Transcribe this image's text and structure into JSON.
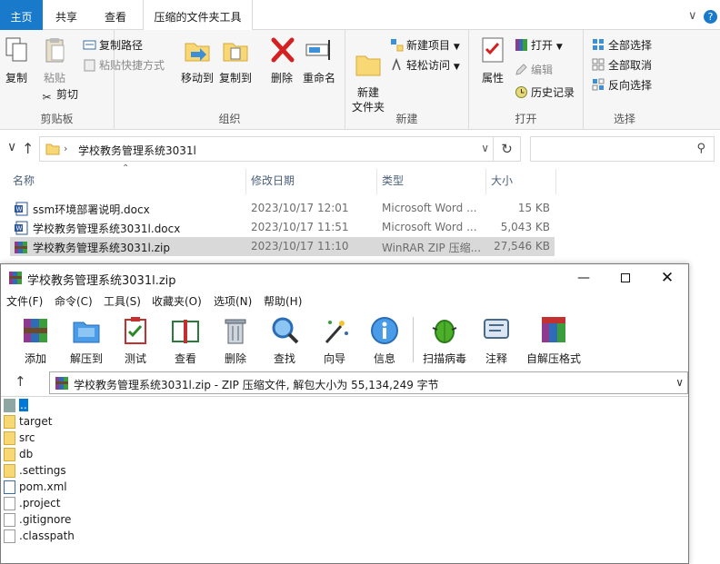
{
  "explorer": {
    "tabs": {
      "file": "主页",
      "share": "共享",
      "view": "查看",
      "tools": "压缩的文件夹工具"
    },
    "ribbon": {
      "clipboard": {
        "copy": "复制",
        "paste": "粘贴",
        "copy_path": "复制路径",
        "paste_shortcut": "粘贴快捷方式",
        "cut": "剪切",
        "label": "剪贴板"
      },
      "organize": {
        "move_to": "移动到",
        "copy_to": "复制到",
        "delete": "删除",
        "rename": "重命名",
        "label": "组织"
      },
      "new": {
        "new_folder": "新建\n文件夹",
        "new_item": "新建项目",
        "easy_access": "轻松访问",
        "label": "新建"
      },
      "open": {
        "properties": "属性",
        "open": "打开",
        "edit": "编辑",
        "history": "历史记录",
        "label": "打开"
      },
      "select": {
        "select_all": "全部选择",
        "select_none": "全部取消",
        "invert": "反向选择",
        "label": "选择"
      }
    },
    "address": {
      "path": "学校教务管理系统3031l"
    },
    "columns": {
      "name": "名称",
      "date": "修改日期",
      "type": "类型",
      "size": "大小"
    },
    "files": [
      {
        "name": "ssm环境部署说明.docx",
        "date": "2023/10/17 12:01",
        "type": "Microsoft Word ...",
        "size": "15 KB"
      },
      {
        "name": "学校教务管理系统3031l.docx",
        "date": "2023/10/17 11:51",
        "type": "Microsoft Word ...",
        "size": "5,043 KB"
      },
      {
        "name": "学校教务管理系统3031l.zip",
        "date": "2023/10/17 11:10",
        "type": "WinRAR ZIP 压缩...",
        "size": "27,546 KB"
      }
    ]
  },
  "winrar": {
    "title": "学校教务管理系统3031l.zip",
    "menu": [
      "文件(F)",
      "命令(C)",
      "工具(S)",
      "收藏夹(O)",
      "选项(N)",
      "帮助(H)"
    ],
    "toolbar": [
      "添加",
      "解压到",
      "测试",
      "查看",
      "删除",
      "查找",
      "向导",
      "信息",
      "扫描病毒",
      "注释",
      "自解压格式"
    ],
    "address": "学校教务管理系统3031l.zip - ZIP 压缩文件, 解包大小为 55,134,249 字节",
    "items": [
      {
        "name": "..",
        "kind": "up"
      },
      {
        "name": "target",
        "kind": "folder"
      },
      {
        "name": "src",
        "kind": "folder"
      },
      {
        "name": "db",
        "kind": "folder"
      },
      {
        "name": ".settings",
        "kind": "folder"
      },
      {
        "name": "pom.xml",
        "kind": "xml"
      },
      {
        "name": ".project",
        "kind": "file"
      },
      {
        "name": ".gitignore",
        "kind": "file"
      },
      {
        "name": ".classpath",
        "kind": "file"
      }
    ]
  }
}
